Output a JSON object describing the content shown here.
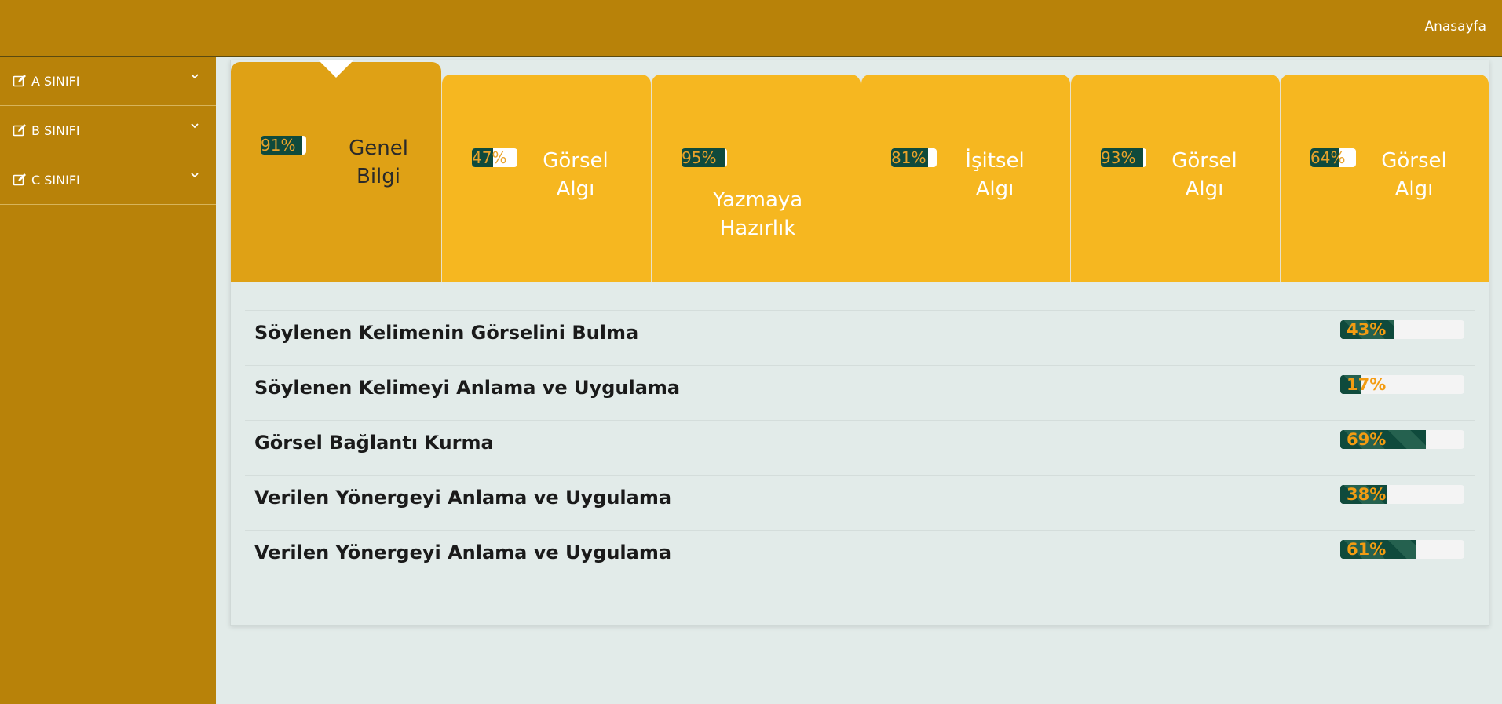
{
  "topbar": {
    "home_link": "Anasayfa"
  },
  "sidebar": {
    "items": [
      {
        "label": "A SINIFI"
      },
      {
        "label": "B SINIFI"
      },
      {
        "label": "C SINIFI"
      }
    ]
  },
  "tabs": [
    {
      "percent": 91,
      "percent_text": "91%",
      "label_line1": "Genel",
      "label_line2": "Bilgi"
    },
    {
      "percent": 47,
      "percent_text": "47%",
      "label_line1": "Görsel",
      "label_line2": "Algı"
    },
    {
      "percent": 95,
      "percent_text": "95%",
      "label_line1": "Yazmaya",
      "label_line2": "Hazırlık"
    },
    {
      "percent": 81,
      "percent_text": "81%",
      "label_line1": "İşitsel",
      "label_line2": "Algı"
    },
    {
      "percent": 93,
      "percent_text": "93%",
      "label_line1": "Görsel",
      "label_line2": "Algı"
    },
    {
      "percent": 64,
      "percent_text": "64%",
      "label_line1": "Görsel",
      "label_line2": "Algı"
    }
  ],
  "rows": [
    {
      "label": "Söylenen Kelimenin Görselini Bulma",
      "percent": 43,
      "percent_text": "43%"
    },
    {
      "label": "Söylenen Kelimeyi Anlama ve Uygulama",
      "percent": 17,
      "percent_text": "17%"
    },
    {
      "label": "Görsel Bağlantı Kurma",
      "percent": 69,
      "percent_text": "69%"
    },
    {
      "label": "Verilen Yönergeyi Anlama ve Uygulama",
      "percent": 38,
      "percent_text": "38%"
    },
    {
      "label": "Verilen Yönergeyi Anlama ve Uygulama",
      "percent": 61,
      "percent_text": "61%"
    }
  ],
  "colors": {
    "header": "#b88209",
    "tab": "#f6b720",
    "tab_active": "#dfa115",
    "progress": "#0f4a3c",
    "progress_text": "#f39c12"
  }
}
